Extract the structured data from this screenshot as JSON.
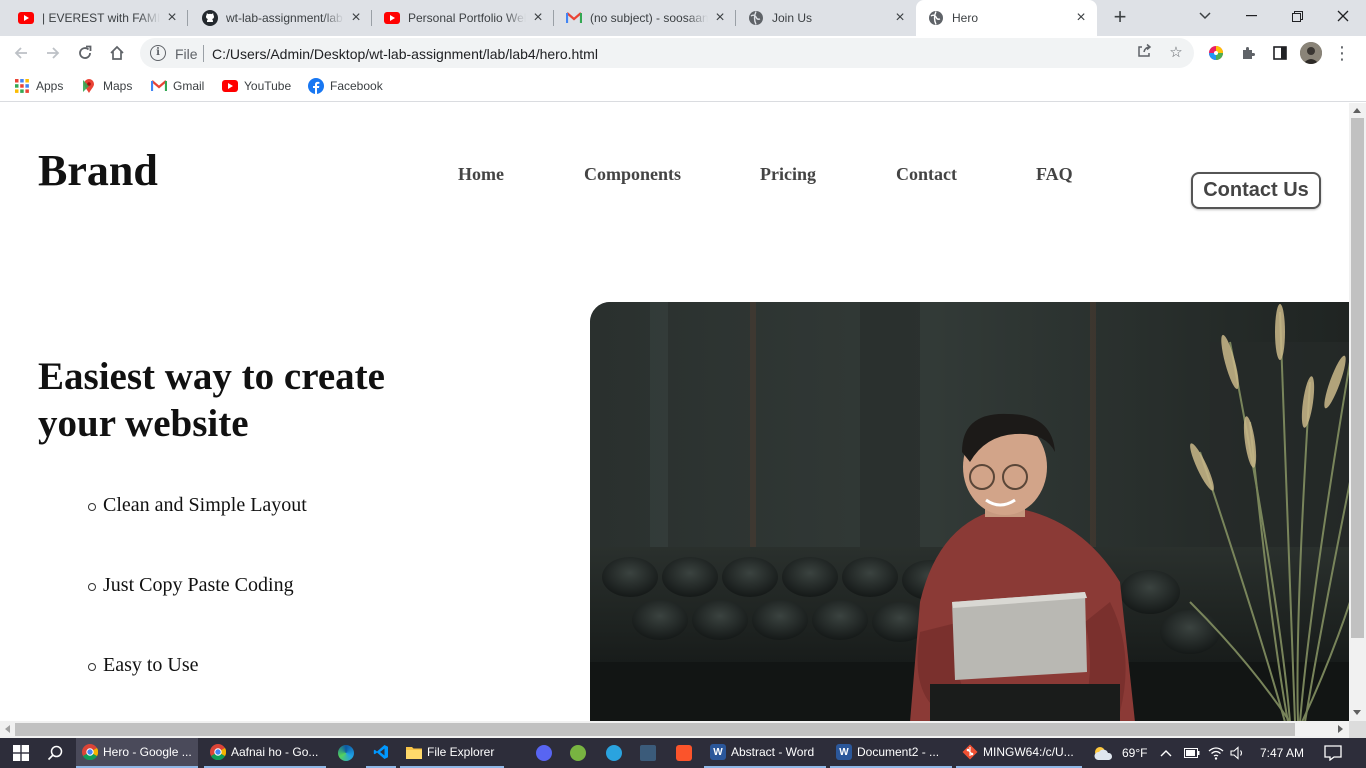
{
  "browser": {
    "tabs": [
      {
        "title": "| EVEREST with FAMILY",
        "icon": "youtube-icon"
      },
      {
        "title": "wt-lab-assignment/lab",
        "icon": "github-icon"
      },
      {
        "title": "Personal Portfolio Web",
        "icon": "youtube-icon"
      },
      {
        "title": "(no subject) - soosaan",
        "icon": "gmail-icon"
      },
      {
        "title": "Join Us",
        "icon": "globe-icon"
      },
      {
        "title": "Hero",
        "icon": "globe-icon",
        "active": true
      }
    ],
    "address": {
      "scheme_label": "File",
      "url": "C:/Users/Admin/Desktop/wt-lab-assignment/lab/lab4/hero.html"
    },
    "bookmarks": [
      {
        "label": "Apps",
        "icon": "apps-grid-icon"
      },
      {
        "label": "Maps",
        "icon": "maps-icon"
      },
      {
        "label": "Gmail",
        "icon": "gmail-icon"
      },
      {
        "label": "YouTube",
        "icon": "youtube-icon"
      },
      {
        "label": "Facebook",
        "icon": "facebook-icon"
      }
    ]
  },
  "page": {
    "brand": "Brand",
    "nav": [
      "Home",
      "Components",
      "Pricing",
      "Contact",
      "FAQ"
    ],
    "cta": "Contact Us",
    "hero_title": "Easiest way to create your website",
    "features": [
      "Clean and Simple Layout",
      "Just Copy Paste Coding",
      "Easy to Use"
    ]
  },
  "taskbar": {
    "apps": [
      {
        "label": "Hero - Google ...",
        "icon": "chrome-icon",
        "state": "active"
      },
      {
        "label": "Aafnai ho - Go...",
        "icon": "chrome-icon",
        "state": "open"
      },
      {
        "label": "File Explorer",
        "icon": "folder-icon",
        "state": "open"
      },
      {
        "label": "Abstract - Word",
        "icon": "word-icon",
        "state": "open"
      },
      {
        "label": "Document2 - ...",
        "icon": "word-icon",
        "state": "open"
      },
      {
        "label": "MINGW64:/c/U...",
        "icon": "git-bash-icon",
        "state": "open"
      }
    ],
    "weather": "69°F",
    "time": "7:47 AM"
  },
  "colors": {
    "tab_strip": "#dee1e6",
    "taskbar": "#2d2d3a",
    "cta_border": "#555555",
    "nav_text": "#444444"
  }
}
